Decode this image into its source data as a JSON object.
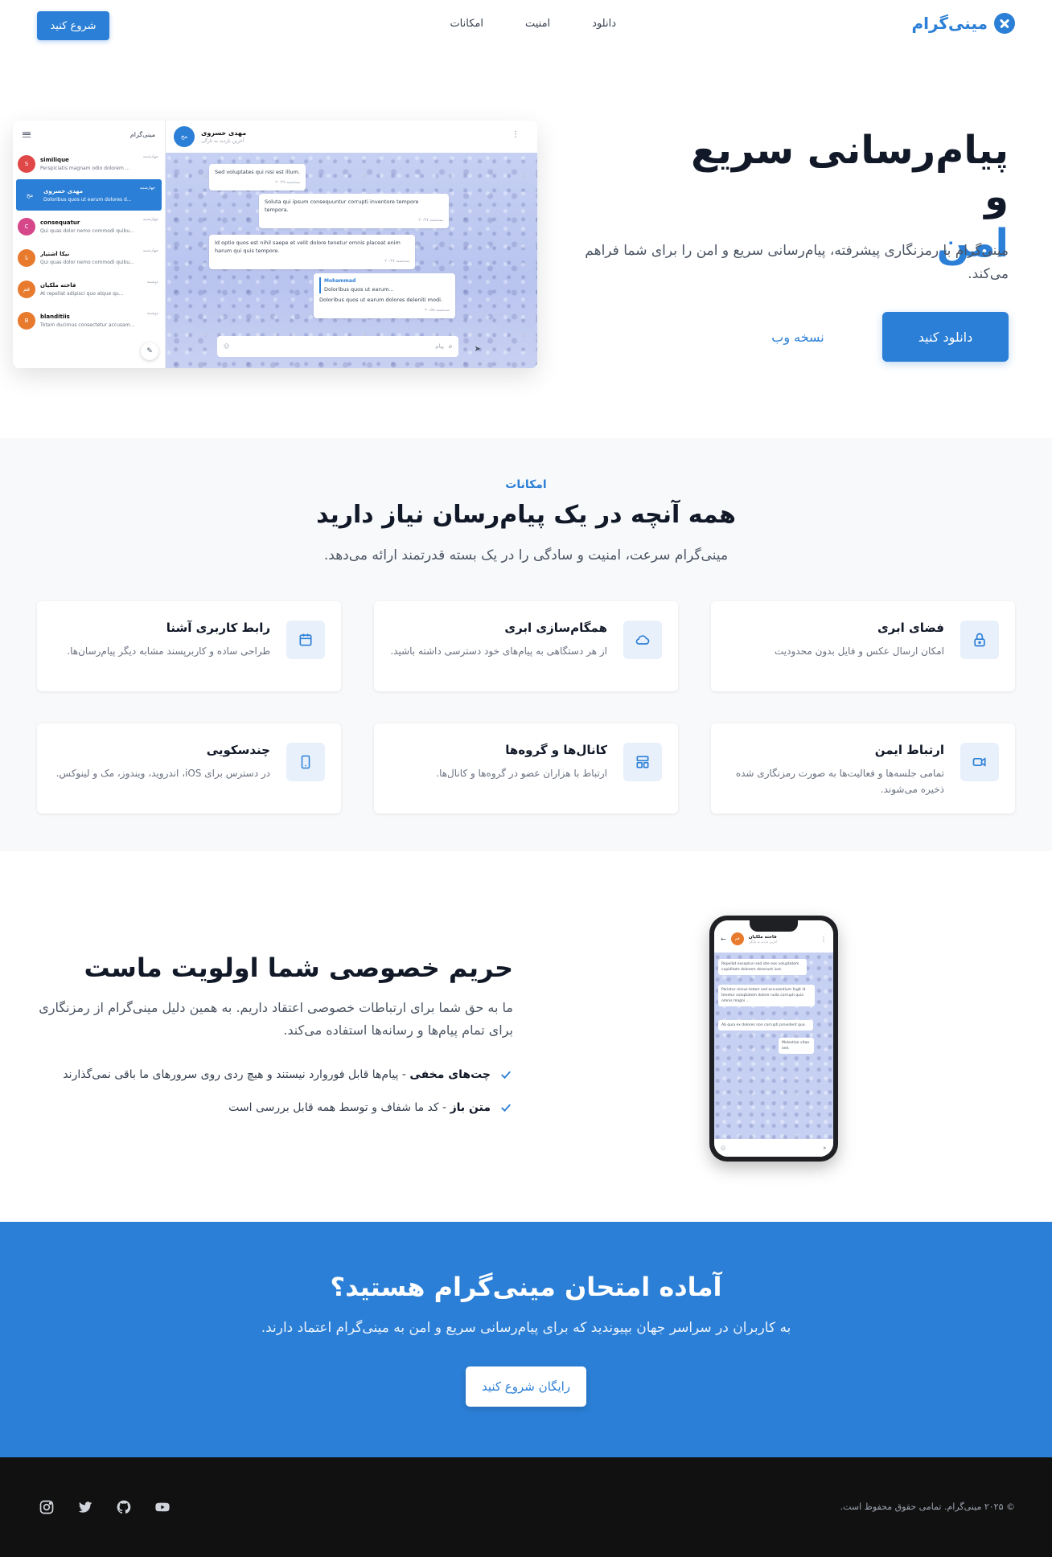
{
  "header": {
    "brand": "مینی‌گرام",
    "nav": [
      "دانلود",
      "امنیت",
      "امکانات"
    ],
    "start_button": "شروع کنید"
  },
  "hero": {
    "title_line1": "پیام‌رسانی سریع و",
    "title_line2": "امن",
    "description": "مینی‌گرام با رمزنگاری پیشرفته، پیام‌رسانی سریع و امن را برای شما فراهم می‌کند.",
    "download_button": "دانلود کنید",
    "web_button": "نسخه وب"
  },
  "mock_app": {
    "sidebar_title": "مینی‌گرام",
    "chats": [
      {
        "initial": "S",
        "name": "similique",
        "preview": "Perspiciatis magnam odio dolorem ...",
        "time": "چهارشنبه",
        "color": "#e04848"
      },
      {
        "initial": "مخ",
        "name": "مهدی خسروی",
        "preview": "Doloribus quos ut earum dolores d...",
        "time": "چهارشنبه",
        "color": "#2b7fd6"
      },
      {
        "initial": "C",
        "name": "consequatur",
        "preview": "Qui quas dolor nemo commodi quibu...",
        "time": "چهارشنبه",
        "color": "#d6478a"
      },
      {
        "initial": "نا",
        "name": "نیکا اشتیار",
        "preview": "Qui quas dolor nemo commodi quibu...",
        "time": "چهارشنبه",
        "color": "#e87a2e"
      },
      {
        "initial": "فم",
        "name": "فاخته ملکیان",
        "preview": "At repellat adipisci quo atque qu...",
        "time": "دوشنبه",
        "color": "#e87a2e"
      },
      {
        "initial": "B",
        "name": "blanditiis",
        "preview": "Totam ducimus consectetur accusam...",
        "time": "دوشنبه",
        "color": "#e87a2e"
      }
    ],
    "chat_header": {
      "initial": "مخ",
      "name": "مهدی خسروی",
      "status": "آخرین بازدید به تازگی"
    },
    "messages": [
      {
        "text": "Sed voluptates qui nisi est illum.",
        "time": "۲۰:۴۷ سه‌شنبه"
      },
      {
        "text": "Soluta qui ipsum consequuntur corrupti inventore tempore tempora.",
        "time": "۲۰:۴۷ سه‌شنبه"
      },
      {
        "text": "Id optio quos est nihil saepe et velit dolore tenetur omnis placeat enim harum qui quis tempore.",
        "time": "۲۰:۴۷ سه‌شنبه"
      },
      {
        "reply_name": "Mohammad",
        "reply_text": "Doloribus quos ut earum...",
        "text": "Doloribus quos ut earum dolores deleniti modi.",
        "time": "۲۰:۵۸ سه‌شنبه"
      }
    ],
    "input_placeholder": "پیام"
  },
  "features": {
    "kicker": "امکانات",
    "title": "همه آنچه در یک پیام‌رسان نیاز دارید",
    "subtitle": "مینی‌گرام سرعت، امنیت و سادگی را در یک بسته قدرتمند ارائه می‌دهد.",
    "cards": [
      {
        "title": "فضای ابری",
        "desc": "امکان ارسال عکس و فایل بدون محدودیت",
        "icon": "lock-icon"
      },
      {
        "title": "همگام‌سازی ابری",
        "desc": "از هر دستگاهی به پیام‌های خود دسترسی داشته باشید.",
        "icon": "cloud-icon"
      },
      {
        "title": "رابط کاربری آشنا",
        "desc": "طراحی ساده و کاربرپسند مشابه دیگر پیام‌رسان‌ها.",
        "icon": "calendar-icon"
      },
      {
        "title": "ارتباط ایمن",
        "desc": "تمامی جلسه‌ها و فعالیت‌ها به صورت رمزنگاری شده ذخیره می‌شوند.",
        "icon": "video-icon"
      },
      {
        "title": "کانال‌ها و گروه‌ها",
        "desc": "ارتباط با هزاران عضو در گروه‌ها و کانال‌ها.",
        "icon": "layout-icon"
      },
      {
        "title": "چندسکویی",
        "desc": "در دسترس برای iOS، اندروید، ویندوز، مک و لینوکس.",
        "icon": "phone-icon"
      }
    ]
  },
  "privacy": {
    "title": "حریم خصوصی شما اولویت ماست",
    "description": "ما به حق شما برای ارتباطات خصوصی اعتقاد داریم. به همین دلیل مینی‌گرام از رمزنگاری برای تمام پیام‌ها و رسانه‌ها استفاده می‌کند.",
    "items": [
      {
        "bold": "چت‌های مخفی",
        "text": " - پیام‌ها قابل فوروارد نیستند و هیچ ردی روی سرورهای ما باقی نمی‌گذارند"
      },
      {
        "bold": "متن باز",
        "text": " - کد ما شفاف و توسط همه قابل بررسی است"
      }
    ],
    "phone": {
      "name": "فاخته ملکیان",
      "status": "آخرین بازدید به تازگی",
      "initial": "فم",
      "messages": [
        "Repellat excepturi sed iste eos voluptatem cupiditate dolorem deserunt iure.",
        "Pariatur minus totam sed accusantium fugit id tenetur voluptatem dolore nulla corrupti quia omnis magni ...",
        "Ab quia ex dolores non corrupti provident quo.",
        "Molestiae vitae sed."
      ]
    }
  },
  "cta": {
    "title": "آماده امتحان مینی‌گرام هستید؟",
    "subtitle": "به کاربران در سراسر جهان بپیوندید که برای پیام‌رسانی سریع و امن به مینی‌گرام اعتماد دارند.",
    "button": "رایگان شروع کنید"
  },
  "footer": {
    "copyright": "© ۲۰۲۵ مینی‌گرام. تمامی حقوق محفوظ است.",
    "social": [
      "instagram-icon",
      "twitter-icon",
      "github-icon",
      "youtube-icon"
    ]
  },
  "colors": {
    "primary": "#2b7fd6",
    "footer_bg": "#111111",
    "section_bg": "#f8f9fb"
  }
}
